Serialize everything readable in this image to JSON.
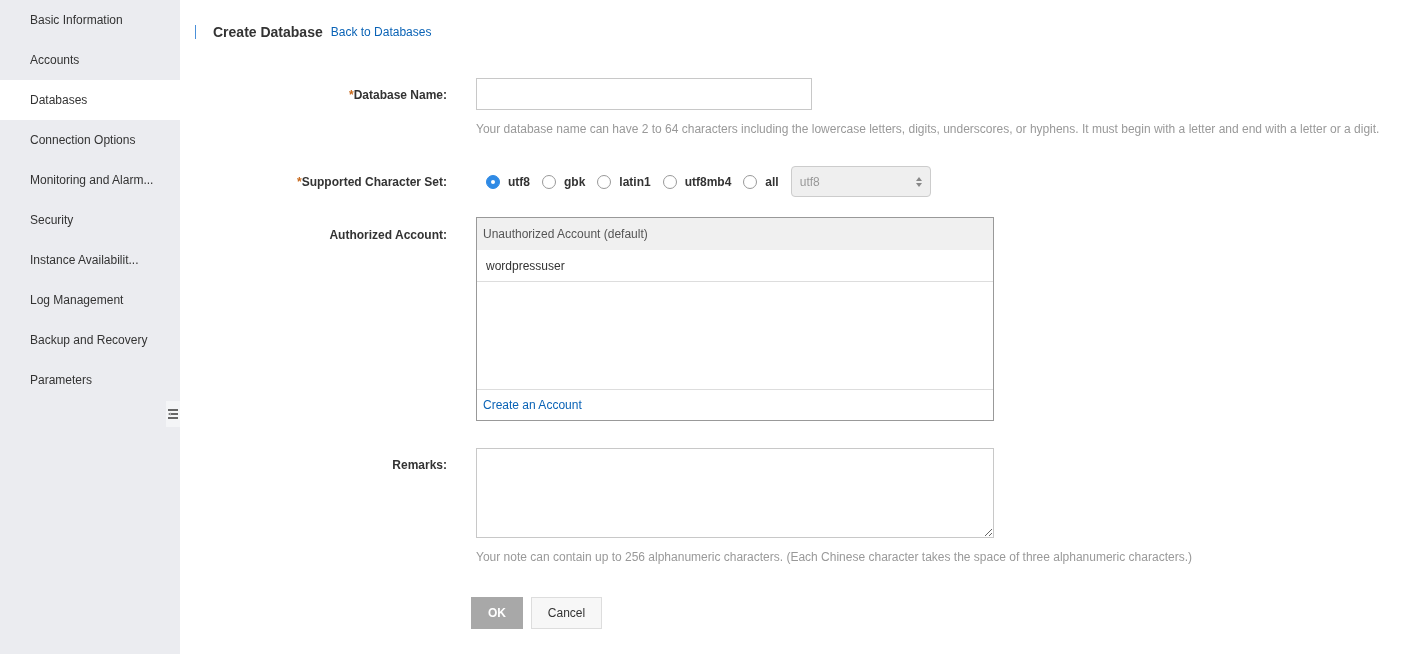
{
  "sidebar": {
    "items": [
      {
        "label": "Basic Information",
        "selected": false
      },
      {
        "label": "Accounts",
        "selected": false
      },
      {
        "label": "Databases",
        "selected": true
      },
      {
        "label": "Connection Options",
        "selected": false
      },
      {
        "label": "Monitoring and Alarm...",
        "selected": false
      },
      {
        "label": "Security",
        "selected": false
      },
      {
        "label": "Instance Availabilit...",
        "selected": false
      },
      {
        "label": "Log Management",
        "selected": false
      },
      {
        "label": "Backup and Recovery",
        "selected": false
      },
      {
        "label": "Parameters",
        "selected": false
      }
    ]
  },
  "header": {
    "title": "Create Database",
    "back_link": "Back to Databases"
  },
  "form": {
    "database_name": {
      "required_mark": "*",
      "label": "Database Name:",
      "hint": "Your database name can have 2 to 64 characters including the lowercase letters, digits, underscores, or hyphens. It must begin with a letter and end with a letter or a digit."
    },
    "character_set": {
      "required_mark": "*",
      "label": "Supported Character Set:",
      "options": [
        {
          "label": "utf8",
          "selected": true
        },
        {
          "label": "gbk",
          "selected": false
        },
        {
          "label": "latin1",
          "selected": false
        },
        {
          "label": "utf8mb4",
          "selected": false
        },
        {
          "label": "all",
          "selected": false
        }
      ],
      "select": {
        "value": "utf8",
        "disabled": true
      }
    },
    "authorized_account": {
      "label": "Authorized Account:",
      "header": "Unauthorized Account (default)",
      "accounts": [
        "wordpressuser"
      ],
      "footer_link": "Create an Account"
    },
    "remarks": {
      "label": "Remarks:",
      "hint": "Your note can contain up to 256 alphanumeric characters. (Each Chinese character takes the space of three alphanumeric characters.)"
    },
    "buttons": [
      {
        "label": "OK",
        "kind": "primary",
        "disabled": true
      },
      {
        "label": "Cancel",
        "kind": "secondary",
        "disabled": false
      }
    ]
  }
}
